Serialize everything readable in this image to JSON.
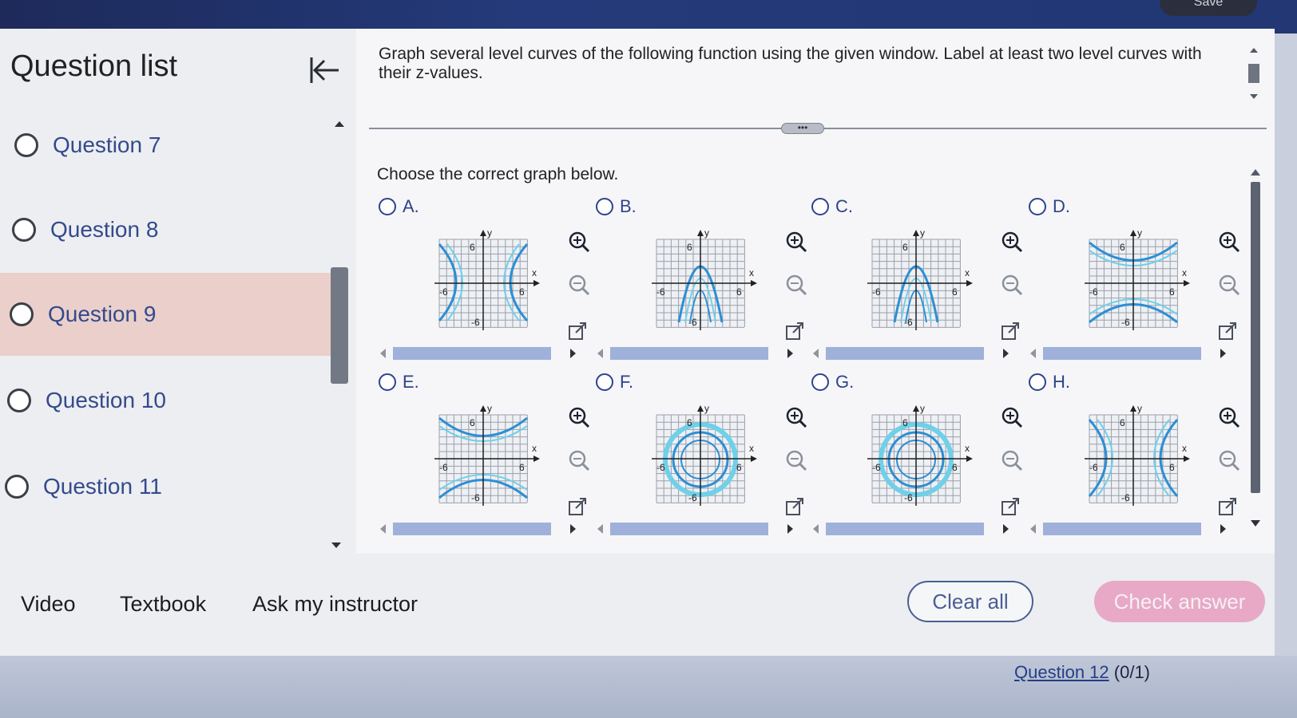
{
  "header": {
    "save_label": "Save"
  },
  "sidebar": {
    "title": "Question list",
    "items": [
      {
        "label": "Question 7"
      },
      {
        "label": "Question 8"
      },
      {
        "label": "Question 9",
        "active": true
      },
      {
        "label": "Question 10"
      },
      {
        "label": "Question 11"
      }
    ]
  },
  "question": {
    "prompt": "Graph several level curves of the following function using the given window. Label at least two level curves with their z-values.",
    "instruction": "Choose the correct graph below.",
    "options": [
      {
        "letter": "A.",
        "shape": "hyperbola-horizontal"
      },
      {
        "letter": "B.",
        "shape": "parabola-down"
      },
      {
        "letter": "C.",
        "shape": "parabola-down"
      },
      {
        "letter": "D.",
        "shape": "hyperbola-vertical"
      },
      {
        "letter": "E.",
        "shape": "hyperbola-vertical"
      },
      {
        "letter": "F.",
        "shape": "circles"
      },
      {
        "letter": "G.",
        "shape": "circles"
      },
      {
        "letter": "H.",
        "shape": "hyperbola-horizontal"
      }
    ],
    "axis": {
      "x_label": "x",
      "y_label": "y",
      "tick_pos": "6",
      "tick_neg": "-6"
    }
  },
  "bottom": {
    "links": [
      "Video",
      "Textbook",
      "Ask my instructor"
    ],
    "clear_label": "Clear all",
    "check_label": "Check answer"
  },
  "footer": {
    "question_link": "Question 12",
    "score": "(0/1)"
  },
  "colors": {
    "accent": "#2e438a",
    "curve": "#2b8fd6",
    "check_button": "#e7a9c6"
  },
  "icons": [
    "collapse-left-icon",
    "zoom-in-icon",
    "zoom-out-icon",
    "external-link-icon"
  ]
}
